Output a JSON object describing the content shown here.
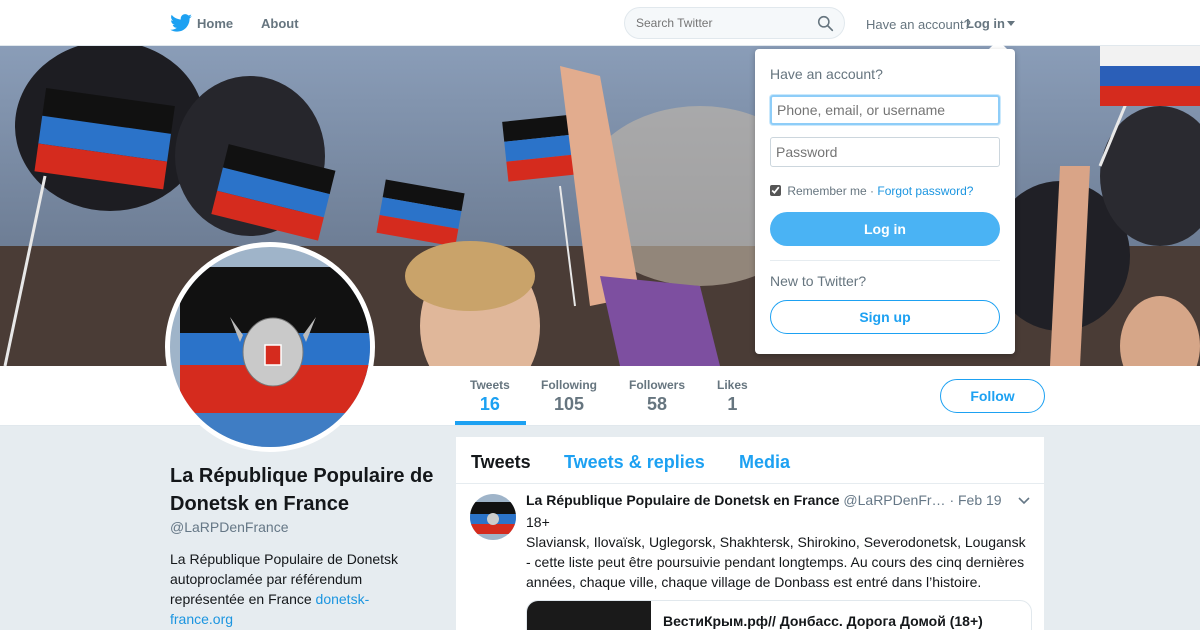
{
  "nav": {
    "home_label": "Home",
    "about_label": "About",
    "search_placeholder": "Search Twitter",
    "have_account_text": "Have an account?",
    "login_label": "Log in"
  },
  "login_dropdown": {
    "title": "Have an account?",
    "username_placeholder": "Phone, email, or username",
    "password_placeholder": "Password",
    "remember_label": "Remember me",
    "separator": "·",
    "forgot_label": "Forgot password?",
    "login_button": "Log in",
    "new_prompt": "New to Twitter?",
    "signup_button": "Sign up"
  },
  "stats": [
    {
      "label": "Tweets",
      "value": "16"
    },
    {
      "label": "Following",
      "value": "105"
    },
    {
      "label": "Followers",
      "value": "58"
    },
    {
      "label": "Likes",
      "value": "1"
    }
  ],
  "follow_button": "Follow",
  "profile": {
    "name": "La République Populaire de Donetsk en France",
    "handle": "@LaRPDenFrance",
    "bio": "La République Populaire de Donetsk autoproclamée par référendum représentée en France ",
    "bio_link": "donetsk-france.org"
  },
  "timeline": {
    "tabs": [
      "Tweets",
      "Tweets & replies",
      "Media"
    ]
  },
  "tweet": {
    "name": "La République Populaire de Donetsk en France",
    "handle": "@LaRPDenFr…",
    "separator": "·",
    "date": "Feb 19",
    "text_line1": "18+",
    "text_body": "Slaviansk, Ilovaïsk, Uglegorsk, Shakhtersk, Shirokino, Severodonetsk, Lougansk - cette liste peut être poursuivie pendant longtemps. Au cours des cinq dernières années, chaque ville, chaque village de Donbass est entré dans l’histoire.",
    "card_title": "ВестиКрым.рф// Донбасс. Дорога Домой (18+)"
  },
  "colors": {
    "accent": "#1da1f2",
    "background": "#e6ecf0",
    "flag_black": "#111111",
    "flag_red": "#d52b1e",
    "flag_blue": "#2b73c9"
  },
  "icons": [
    "twitter-bird-icon",
    "search-icon",
    "caret-down-icon",
    "chevron-down-icon"
  ]
}
